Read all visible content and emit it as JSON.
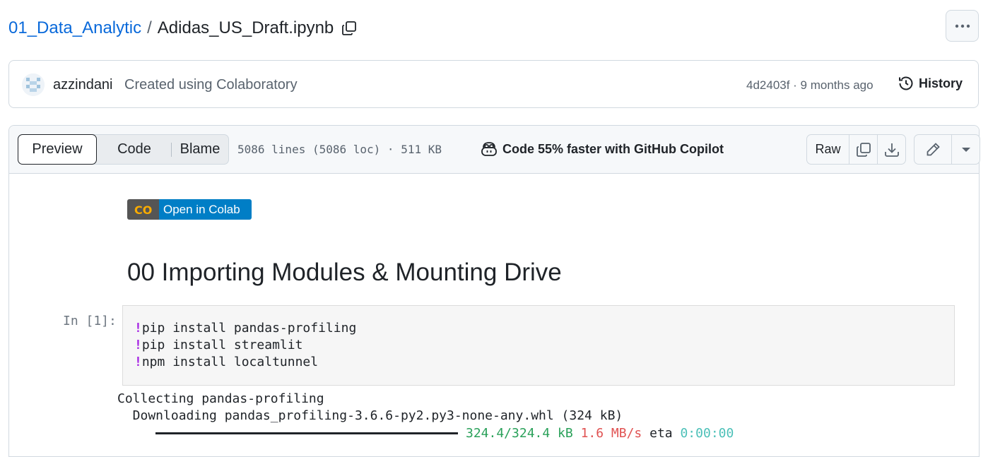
{
  "breadcrumb": {
    "repo": "01_Data_Analytic",
    "separator": "/",
    "file": "Adidas_US_Draft.ipynb"
  },
  "commit": {
    "author": "azzindani",
    "message": "Created using Colaboratory",
    "meta": "4d2403f · 9 months ago",
    "history_label": "History"
  },
  "file_header": {
    "tabs": [
      "Preview",
      "Code",
      "Blame"
    ],
    "active_tab": "Preview",
    "info": "5086 lines (5086 loc) · 511 KB",
    "copilot_text": "Code 55% faster with GitHub Copilot",
    "raw_label": "Raw"
  },
  "notebook": {
    "badge_text": "Open in Colab",
    "badge_logo": "CO",
    "heading": "00 Importing Modules & Mounting Drive",
    "cell_prompt": "In [1]:",
    "code_lines": [
      {
        "bang": "!",
        "text": "pip install pandas-profiling"
      },
      {
        "bang": "!",
        "text": "pip install streamlit"
      },
      {
        "bang": "!",
        "text": "npm install localtunnel"
      }
    ],
    "output": {
      "line1": "Collecting pandas-profiling",
      "line2": "  Downloading pandas_profiling-3.6.6-py2.py3-none-any.whl (324 kB)",
      "progress_size": "324.4/324.4 kB",
      "progress_speed": "1.6 MB/s",
      "progress_eta_label": "eta",
      "progress_eta": "0:00:00"
    }
  },
  "colors": {
    "link": "#0969da",
    "colab_blue": "#007ec6",
    "colab_orange": "#f9ab00"
  }
}
